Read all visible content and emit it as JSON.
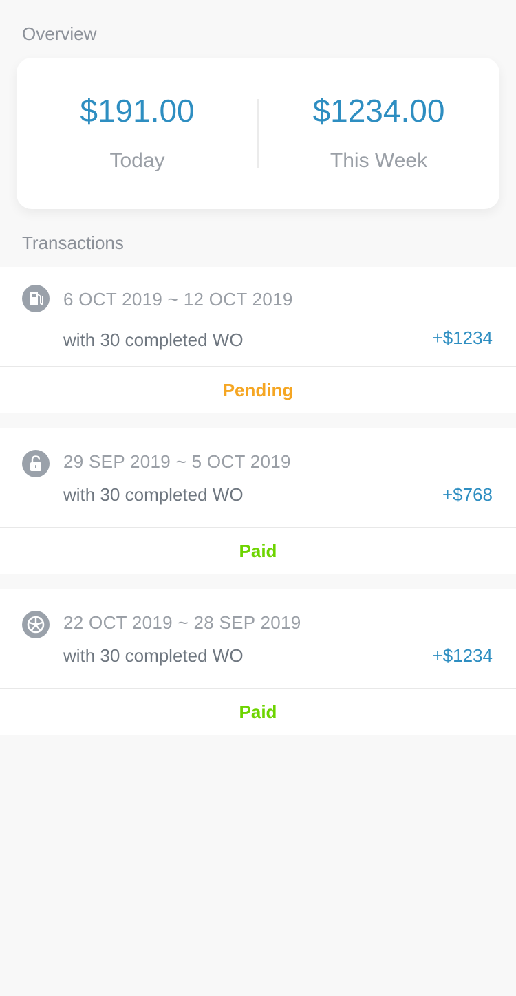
{
  "overview": {
    "title": "Overview",
    "today_amount": "$191.00",
    "today_label": "Today",
    "week_amount": "$1234.00",
    "week_label": "This Week"
  },
  "transactions": {
    "title": "Transactions",
    "items": [
      {
        "icon": "fuel-pump-icon",
        "date_range": "6 OCT 2019 ~ 12 OCT 2019",
        "description": "with 30 completed WO",
        "amount": "+$1234",
        "status": "Pending",
        "status_color": "#f5a623"
      },
      {
        "icon": "unlocked-padlock-icon",
        "date_range": "29 SEP 2019 ~ 5 OCT 2019",
        "description": "with 30 completed WO",
        "amount": "+$768",
        "status": "Paid",
        "status_color": "#6dd400"
      },
      {
        "icon": "wheel-icon",
        "date_range": "22 OCT 2019 ~ 28 SEP 2019",
        "description": "with 30 completed WO",
        "amount": "+$1234",
        "status": "Paid",
        "status_color": "#6dd400"
      }
    ]
  },
  "colors": {
    "accent": "#2e8ec1",
    "pending": "#f5a623",
    "paid": "#6dd400",
    "background": "#f8f8f8"
  }
}
